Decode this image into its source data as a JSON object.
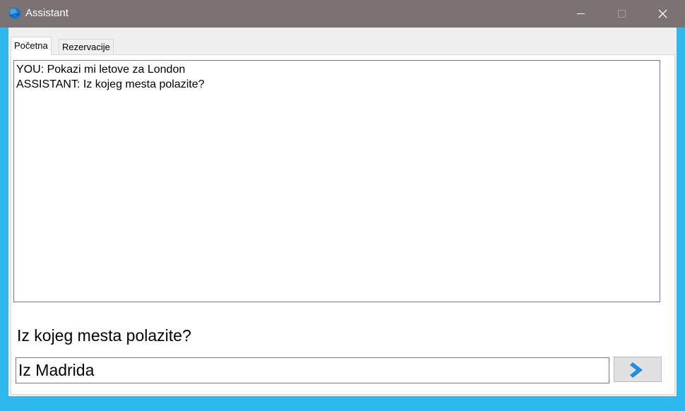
{
  "window": {
    "title": "Assistant",
    "icon": "assistant-globe-icon",
    "controls": [
      "minimize-icon",
      "maximize-icon",
      "close-icon"
    ]
  },
  "tabs": [
    {
      "label": "Početna",
      "selected": true
    },
    {
      "label": "Rezervacije",
      "selected": false
    }
  ],
  "chat": {
    "lines": [
      "YOU: Pokazi mi letove za London",
      "ASSISTANT: Iz kojeg mesta polazite?"
    ]
  },
  "prompt": {
    "question": "Iz kojeg mesta polazite?"
  },
  "input": {
    "value": "Iz Madrida",
    "focused": true
  },
  "send_button": {
    "icon": "chevron-right-icon"
  },
  "colors": {
    "titlebar": "#7a7371",
    "frame": "#2fb8ee",
    "accent": "#1e8fe0"
  }
}
